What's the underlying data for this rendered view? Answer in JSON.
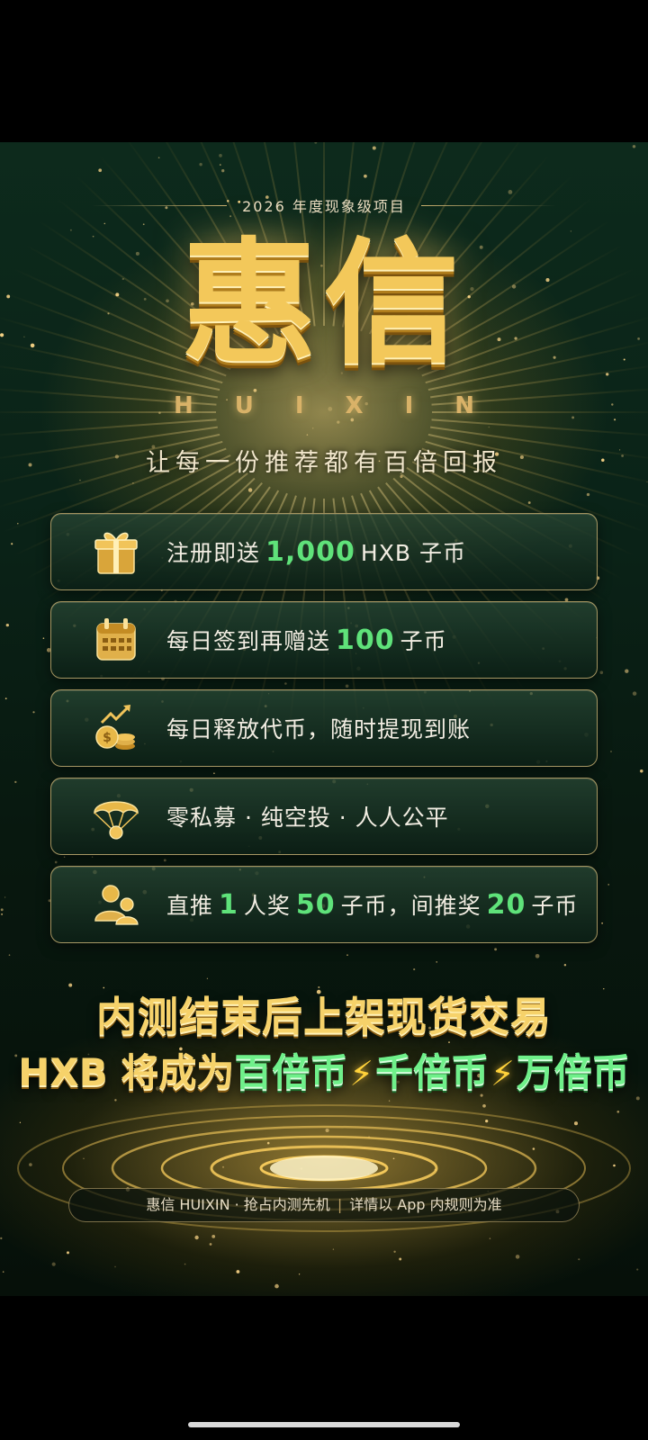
{
  "header": {
    "eyebrow": "2026 年度现象级项目"
  },
  "brand": {
    "name_cn": "惠信",
    "name_en": "HUIXIN"
  },
  "slogan": "让每一份推荐都有百倍回报",
  "features": [
    {
      "icon": "gift-icon",
      "pre": "注册即送",
      "value": "1,000",
      "post": "HXB 子币"
    },
    {
      "icon": "calendar-icon",
      "pre": "每日签到再赠送",
      "value": "100",
      "post": "子币"
    },
    {
      "icon": "coins-growth-icon",
      "text": "每日释放代币，随时提现到账"
    },
    {
      "icon": "parachute-coin-icon",
      "text": "零私募 · 纯空投 · 人人公平"
    },
    {
      "icon": "referral-users-icon",
      "p1": "直推",
      "v1": "1",
      "p2": "人奖",
      "v2": "50",
      "p3": "子币，间推奖",
      "v3": "20",
      "p4": "子币"
    }
  ],
  "headline": {
    "line1": "内测结束后上架现货交易",
    "line2_prefix": "HXB 将成为",
    "tier1": "百倍币",
    "tier2": "千倍币",
    "tier3": "万倍币"
  },
  "footer": {
    "left": "惠信 HUIXIN · 抢占内测先机",
    "separator": "|",
    "right": "详情以 App 内规则为准"
  },
  "colors": {
    "gold": "#f3c85a",
    "highlight_green": "#5fe27a",
    "background": "#0a2217"
  }
}
